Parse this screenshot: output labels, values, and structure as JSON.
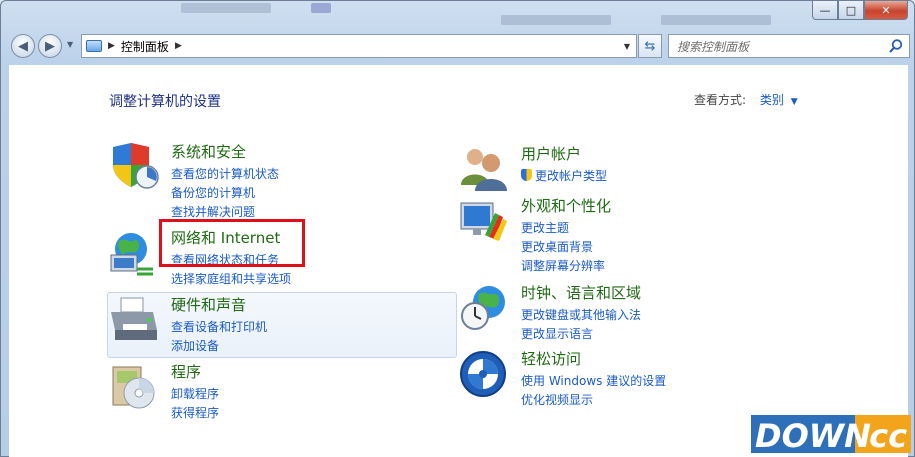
{
  "titlebar": {
    "minimize": "—",
    "maximize": "□",
    "close": "✕"
  },
  "nav": {
    "back_icon": "back-arrow-icon",
    "forward_icon": "forward-arrow-icon",
    "address_path": "控制面板",
    "search_placeholder": "搜索控制面板"
  },
  "content": {
    "heading": "调整计算机的设置",
    "view_by_label": "查看方式:",
    "view_by_value": "类别"
  },
  "categories": [
    {
      "title": "系统和安全",
      "icon": "shield-system-icon",
      "links": [
        "查看您的计算机状态",
        "备份您的计算机",
        "查找并解决问题"
      ]
    },
    {
      "title": "网络和 Internet",
      "icon": "network-globe-icon",
      "links": [
        "查看网络状态和任务",
        "选择家庭组和共享选项"
      ]
    },
    {
      "title": "硬件和声音",
      "icon": "printer-icon",
      "links": [
        "查看设备和打印机",
        "添加设备"
      ]
    },
    {
      "title": "程序",
      "icon": "programs-disc-icon",
      "links": [
        "卸载程序",
        "获得程序"
      ]
    },
    {
      "title": "用户帐户",
      "icon": "users-icon",
      "links": [
        "更改帐户类型"
      ]
    },
    {
      "title": "外观和个性化",
      "icon": "display-paint-icon",
      "links": [
        "更改主题",
        "更改桌面背景",
        "调整屏幕分辨率"
      ]
    },
    {
      "title": "时钟、语言和区域",
      "icon": "clock-globe-icon",
      "links": [
        "更改键盘或其他输入法",
        "更改显示语言"
      ]
    },
    {
      "title": "轻松访问",
      "icon": "ease-of-access-icon",
      "links": [
        "使用 Windows 建议的设置",
        "优化视频显示"
      ]
    }
  ],
  "watermark": {
    "text_a": "DOWN",
    "text_b": ".cc"
  },
  "colors": {
    "accent_link": "#1a5bc7",
    "category_title": "#1f6b13",
    "heading": "#1e3287",
    "highlight": "#e0101a"
  }
}
